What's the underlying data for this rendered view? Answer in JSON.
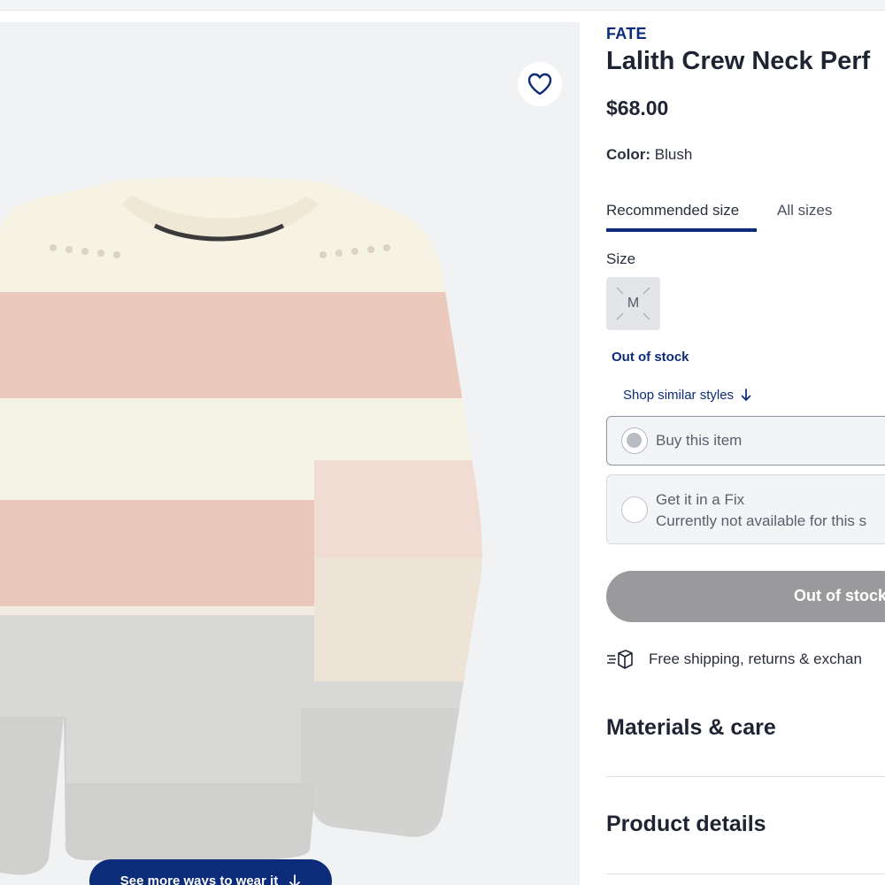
{
  "gallery": {
    "favorite_icon": "heart-outline-icon",
    "see_more_label": "See more ways to wear it",
    "see_more_icon": "arrow-down-icon"
  },
  "product": {
    "brand": "FATE",
    "title": "Lalith Crew Neck Perf",
    "price": "$68.00",
    "color_label": "Color:",
    "color_value": "Blush"
  },
  "size_tabs": [
    {
      "label": "Recommended size",
      "active": true
    },
    {
      "label": "All sizes",
      "active": false
    }
  ],
  "size": {
    "label": "Size",
    "options": [
      {
        "label": "M",
        "available": false
      }
    ]
  },
  "stock_status": "Out of stock",
  "similar_link": "Shop similar styles",
  "purchase_options": {
    "buy": {
      "label": "Buy this item",
      "selected": true
    },
    "fix": {
      "label": "Get it in a Fix",
      "note": "Currently not available for this s"
    }
  },
  "cta_label": "Out of stock",
  "shipping_text": "Free shipping, returns & exchan",
  "sections": [
    "Materials & care",
    "Product details"
  ],
  "colors": {
    "brand_navy": "#0c2c79",
    "disabled_button": "#9a9a9c",
    "text_dark": "#1f2433"
  }
}
